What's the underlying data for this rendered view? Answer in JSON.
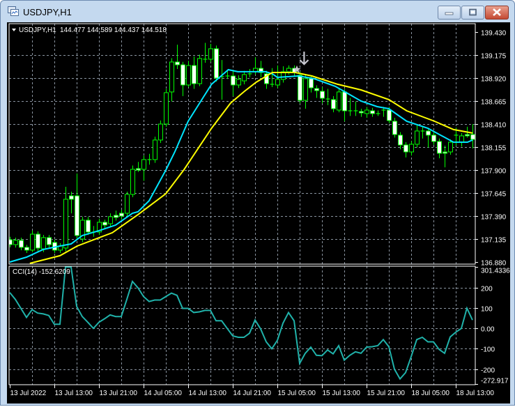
{
  "window": {
    "title": "USDJPY,H1",
    "icons": {
      "app": "chart-window-icon",
      "minimize": "minimize-icon",
      "maximize": "maximize-icon",
      "close": "close-icon"
    }
  },
  "chart_header": {
    "symbol_label": "USDJPY,H1",
    "ohlc_text": "144.477 144.589 144.437 144.518"
  },
  "colors": {
    "background": "#000000",
    "grid": "#8a94a0",
    "bull_candle": "#00ff00",
    "bear_candle_body": "#ffffff",
    "ma_fast": "#00e5ff",
    "ma_slow": "#ffff00",
    "cci_line": "#20b2aa"
  },
  "chart_data": [
    {
      "type": "candlestick",
      "title": "USDJPY,H1",
      "ylim": [
        136.88,
        139.43
      ],
      "y_ticks": [
        "139.430",
        "139.175",
        "138.920",
        "138.665",
        "138.410",
        "138.155",
        "137.900",
        "137.645",
        "137.390",
        "137.135",
        "136.880"
      ],
      "x_ticks": [
        {
          "index": 0,
          "label": "13 Jul 2022"
        },
        {
          "index": 8,
          "label": "13 Jul 13:00"
        },
        {
          "index": 16,
          "label": "13 Jul 21:00"
        },
        {
          "index": 24,
          "label": "14 Jul 05:00"
        },
        {
          "index": 32,
          "label": "14 Jul 13:00"
        },
        {
          "index": 40,
          "label": "14 Jul 21:00"
        },
        {
          "index": 48,
          "label": "15 Jul 05:00"
        },
        {
          "index": 56,
          "label": "15 Jul 13:00"
        },
        {
          "index": 64,
          "label": "15 Jul 21:00"
        },
        {
          "index": 72,
          "label": "18 Jul 05:00"
        },
        {
          "index": 80,
          "label": "18 Jul 13:00"
        }
      ],
      "grid": true,
      "candles_ohlc": [
        [
          137.127,
          137.16,
          137.043,
          137.073
        ],
        [
          137.073,
          137.15,
          137.04,
          137.12
        ],
        [
          137.12,
          137.15,
          137.01,
          137.043
        ],
        [
          137.043,
          137.07,
          136.98,
          137.012
        ],
        [
          137.012,
          137.23,
          136.99,
          137.189
        ],
        [
          137.189,
          137.22,
          137.0,
          137.035
        ],
        [
          137.027,
          137.18,
          136.99,
          137.151
        ],
        [
          137.151,
          137.18,
          137.04,
          137.073
        ],
        [
          137.097,
          137.13,
          136.98,
          137.012
        ],
        [
          137.012,
          137.09,
          136.98,
          137.058
        ],
        [
          137.035,
          137.715,
          137.0,
          137.576
        ],
        [
          137.614,
          137.66,
          137.42,
          137.576
        ],
        [
          137.614,
          137.862,
          137.13,
          137.174
        ],
        [
          137.135,
          137.38,
          137.1,
          137.344
        ],
        [
          137.344,
          137.38,
          137.18,
          137.213
        ],
        [
          137.213,
          137.28,
          137.16,
          137.213
        ],
        [
          137.213,
          137.36,
          137.18,
          137.321
        ],
        [
          137.321,
          137.35,
          137.25,
          137.29
        ],
        [
          137.305,
          137.42,
          137.27,
          137.383
        ],
        [
          137.398,
          137.45,
          137.34,
          137.375
        ],
        [
          137.421,
          137.46,
          137.35,
          137.39
        ],
        [
          137.421,
          137.66,
          137.39,
          137.63
        ],
        [
          137.63,
          137.95,
          137.6,
          137.908
        ],
        [
          137.916,
          137.99,
          137.88,
          137.9
        ],
        [
          137.908,
          138.06,
          137.78,
          138.016
        ],
        [
          138.016,
          138.08,
          137.96,
          138.016
        ],
        [
          138.016,
          138.27,
          137.98,
          138.233
        ],
        [
          138.233,
          138.45,
          138.2,
          138.41
        ],
        [
          138.41,
          138.8,
          138.38,
          138.758
        ],
        [
          138.766,
          139.14,
          138.66,
          139.098
        ],
        [
          139.098,
          139.29,
          139.02,
          139.067
        ],
        [
          139.067,
          139.1,
          138.72,
          138.843
        ],
        [
          138.843,
          139.11,
          138.82,
          139.059
        ],
        [
          139.059,
          139.16,
          138.8,
          138.858
        ],
        [
          138.858,
          139.18,
          138.83,
          139.137
        ],
        [
          139.129,
          139.31,
          139.09,
          139.129
        ],
        [
          139.129,
          139.3,
          139.1,
          139.245
        ],
        [
          139.245,
          139.28,
          138.88,
          138.92
        ],
        [
          138.936,
          139.12,
          138.68,
          138.936
        ],
        [
          138.943,
          139.0,
          138.91,
          138.943
        ],
        [
          138.943,
          139.0,
          138.72,
          138.843
        ],
        [
          138.843,
          138.95,
          138.81,
          138.905
        ],
        [
          138.889,
          139.0,
          138.85,
          138.959
        ],
        [
          138.967,
          139.02,
          138.93,
          138.967
        ],
        [
          138.99,
          139.15,
          138.96,
          139.028
        ],
        [
          139.028,
          139.11,
          138.93,
          138.982
        ],
        [
          138.967,
          139.0,
          138.8,
          138.858
        ],
        [
          138.851,
          139.03,
          138.82,
          138.851
        ],
        [
          138.843,
          139.06,
          138.81,
          138.905
        ],
        [
          138.905,
          139.05,
          138.87,
          138.99
        ],
        [
          138.99,
          139.06,
          138.96,
          139.028
        ],
        [
          139.028,
          139.06,
          138.94,
          138.982
        ],
        [
          138.951,
          138.99,
          138.64,
          138.673
        ],
        [
          138.673,
          138.95,
          138.58,
          138.913
        ],
        [
          138.913,
          138.95,
          138.76,
          138.812
        ],
        [
          138.804,
          138.84,
          138.7,
          138.781
        ],
        [
          138.773,
          138.82,
          138.64,
          138.696
        ],
        [
          138.688,
          138.8,
          138.62,
          138.688
        ],
        [
          138.681,
          138.72,
          138.54,
          138.58
        ],
        [
          138.565,
          138.8,
          138.54,
          138.766
        ],
        [
          138.766,
          138.8,
          138.44,
          138.557
        ],
        [
          138.557,
          138.7,
          138.5,
          138.557
        ],
        [
          138.557,
          138.66,
          138.5,
          138.557
        ],
        [
          138.549,
          138.58,
          138.49,
          138.534
        ],
        [
          138.526,
          138.6,
          138.48,
          138.565
        ],
        [
          138.557,
          138.59,
          138.49,
          138.526
        ],
        [
          138.526,
          138.56,
          138.5,
          138.526
        ],
        [
          138.565,
          138.6,
          138.49,
          138.565
        ],
        [
          138.565,
          138.6,
          138.42,
          138.449
        ],
        [
          138.441,
          138.48,
          138.26,
          138.294
        ],
        [
          138.287,
          138.32,
          138.13,
          138.178
        ],
        [
          138.178,
          138.21,
          138.04,
          138.101
        ],
        [
          138.101,
          138.22,
          138.06,
          138.186
        ],
        [
          138.186,
          138.4,
          138.15,
          138.333
        ],
        [
          138.333,
          138.38,
          138.25,
          138.333
        ],
        [
          138.333,
          138.36,
          138.15,
          138.287
        ],
        [
          138.287,
          138.32,
          138.18,
          138.217
        ],
        [
          138.217,
          138.25,
          138.03,
          138.086
        ],
        [
          138.101,
          138.17,
          137.93,
          138.086
        ],
        [
          138.101,
          138.24,
          138.07,
          138.209
        ],
        [
          138.287,
          138.37,
          138.17,
          138.287
        ],
        [
          138.209,
          138.31,
          138.16,
          138.279
        ],
        [
          138.294,
          138.38,
          138.26,
          138.279
        ],
        [
          138.294,
          138.41,
          138.14,
          138.24
        ]
      ],
      "moving_averages": [
        {
          "name": "MA fast",
          "color_key": "ma_fast",
          "points": [
            [
              0,
              136.88
            ],
            [
              3,
              136.934
            ],
            [
              6,
              137.019
            ],
            [
              9,
              137.058
            ],
            [
              11,
              137.081
            ],
            [
              13,
              137.174
            ],
            [
              16,
              137.228
            ],
            [
              19,
              137.29
            ],
            [
              22,
              137.421
            ],
            [
              23,
              137.437
            ],
            [
              25,
              137.56
            ],
            [
              28,
              137.9
            ],
            [
              29.6,
              138.101
            ],
            [
              32,
              138.441
            ],
            [
              34.6,
              138.696
            ],
            [
              36.2,
              138.851
            ],
            [
              39.2,
              139.013
            ],
            [
              40.9,
              138.99
            ],
            [
              45.9,
              138.99
            ],
            [
              47.1,
              138.967
            ],
            [
              48,
              138.928
            ],
            [
              51.8,
              138.943
            ],
            [
              54.6,
              138.913
            ],
            [
              58.4,
              138.828
            ],
            [
              63,
              138.665
            ],
            [
              65.9,
              138.603
            ],
            [
              68,
              138.58
            ],
            [
              71.2,
              138.441
            ],
            [
              75,
              138.364
            ],
            [
              79.6,
              138.209
            ],
            [
              82.1,
              138.209
            ],
            [
              83,
              138.233
            ]
          ]
        },
        {
          "name": "MA slow",
          "color_key": "ma_slow",
          "points": [
            [
              3.6,
              136.865
            ],
            [
              9,
              136.95
            ],
            [
              12.1,
              137.058
            ],
            [
              18.4,
              137.205
            ],
            [
              23,
              137.406
            ],
            [
              28,
              137.638
            ],
            [
              31.2,
              137.9
            ],
            [
              36.2,
              138.364
            ],
            [
              39.6,
              138.642
            ],
            [
              42.1,
              138.773
            ],
            [
              44.2,
              138.874
            ],
            [
              47.1,
              138.982
            ],
            [
              51.2,
              138.982
            ],
            [
              54.2,
              138.943
            ],
            [
              58.8,
              138.851
            ],
            [
              63,
              138.789
            ],
            [
              68,
              138.681
            ],
            [
              71.2,
              138.557
            ],
            [
              76.2,
              138.441
            ],
            [
              79.6,
              138.349
            ],
            [
              83,
              138.31
            ]
          ]
        }
      ],
      "annotations": [
        {
          "type": "star",
          "index": 51.5,
          "price": 139.015
        },
        {
          "type": "down-arrow",
          "index": 52.8,
          "price": 139.12
        }
      ]
    },
    {
      "type": "line",
      "title": "CCI(14) -152.6209",
      "ylim": [
        -272.917,
        301.4336
      ],
      "y_ticks": [
        "301.4336",
        "200",
        "100",
        "0.00",
        "-100",
        "-200",
        "-272.917"
      ],
      "y_tick_values": [
        301.4336,
        200,
        100,
        0,
        -100,
        -200,
        -272.917
      ],
      "values": [
        176,
        142,
        98,
        54,
        92,
        75,
        71,
        63,
        20,
        20,
        301,
        301,
        108,
        58,
        30,
        0,
        30,
        47,
        66,
        58,
        58,
        142,
        230,
        199,
        156,
        132,
        139,
        139,
        156,
        173,
        162,
        98,
        98,
        78,
        81,
        88,
        88,
        37,
        37,
        0,
        -37,
        -44,
        -44,
        -24,
        41,
        -3,
        -66,
        -100,
        -59,
        25,
        78,
        37,
        -172,
        -122,
        -92,
        -132,
        -134,
        -106,
        -125,
        -85,
        -156,
        -132,
        -115,
        -122,
        -92,
        -90,
        -85,
        -55,
        -90,
        -200,
        -248,
        -217,
        -139,
        -55,
        -44,
        -66,
        -66,
        -103,
        -122,
        -42,
        -19,
        0,
        99,
        41
      ]
    }
  ]
}
